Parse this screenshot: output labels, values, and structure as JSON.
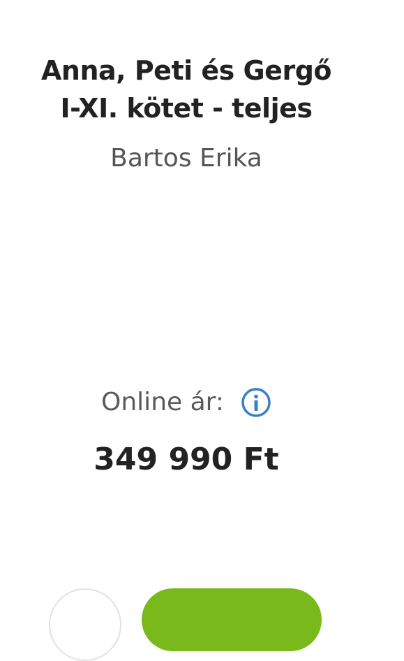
{
  "product": {
    "title_line1": "Anna, Peti és Gergő",
    "title_line2": "I-XI. kötet - teljes",
    "author": "Bartos Erika"
  },
  "pricing": {
    "label": "Online ár:",
    "price": "349 990 Ft",
    "info_icon": "info-circle-icon"
  },
  "actions": {
    "wishlist_icon": "heart-icon",
    "cart_icon": "cart-icon"
  },
  "colors": {
    "accent_blue": "#3a7dc9",
    "cart_green": "#79b91b",
    "title_text": "#222222",
    "muted_text": "#555555"
  }
}
